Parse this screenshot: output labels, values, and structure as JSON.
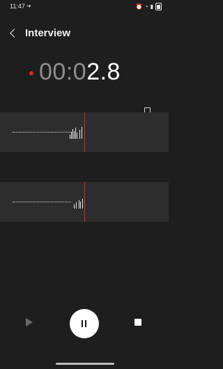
{
  "status_bar": {
    "time": "11:47"
  },
  "header": {
    "title": "Interview"
  },
  "timer": {
    "dim_part": "00:0",
    "bright_part": "2.8"
  },
  "colors": {
    "record_red": "#e0242b",
    "background": "#1e1e1e",
    "track_bg": "#2d2d2d"
  },
  "icons": {
    "back": "chevron-left",
    "bookmark": "doc-settings",
    "play": "play",
    "pause": "pause",
    "stop": "stop"
  }
}
